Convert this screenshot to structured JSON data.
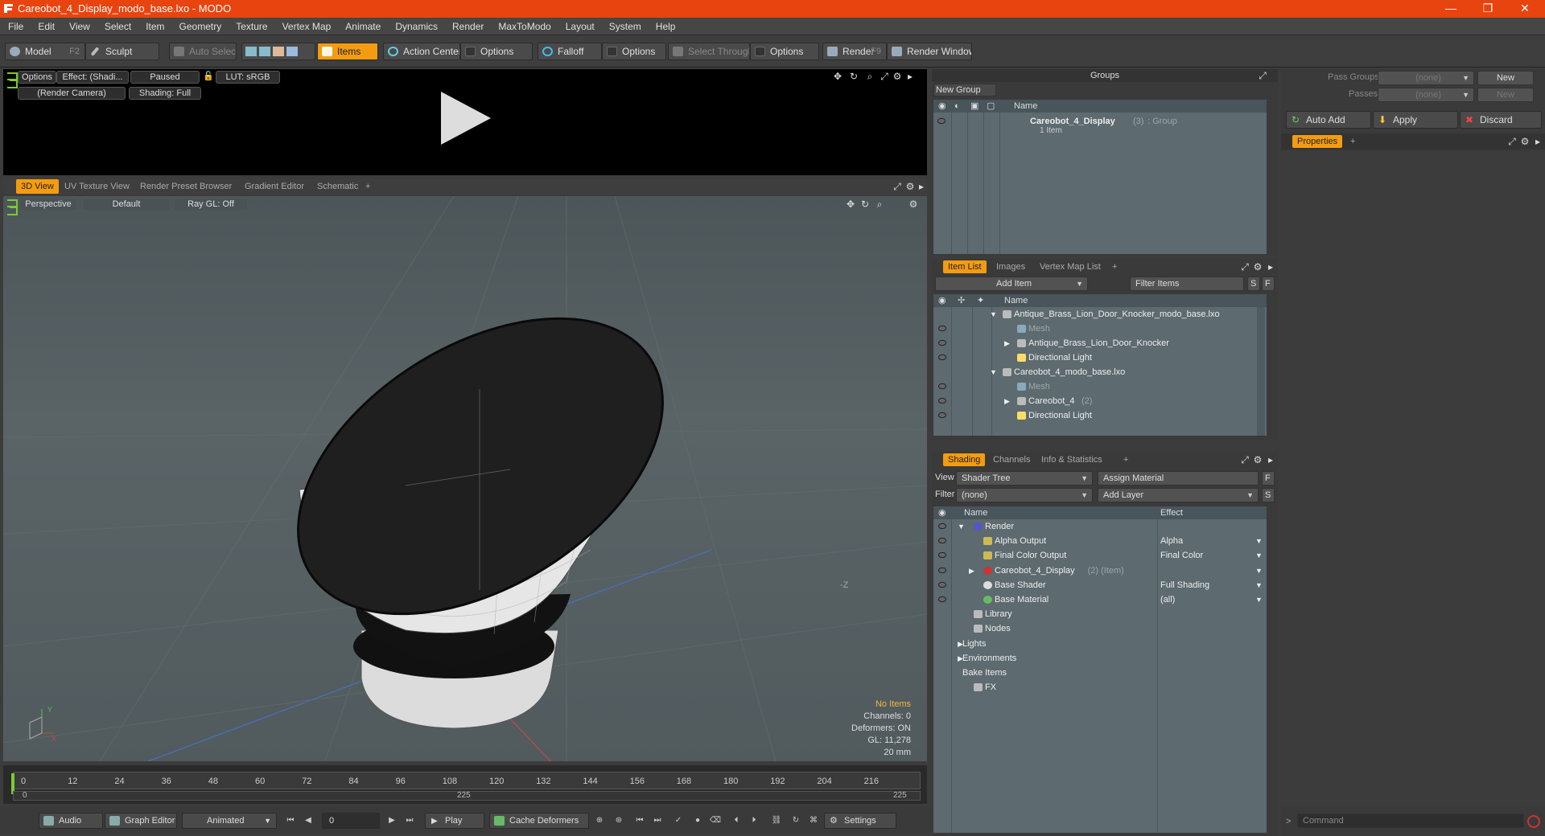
{
  "window": {
    "title": "Careobot_4_Display_modo_base.lxo - MODO",
    "minimize": "—",
    "maximize": "❐",
    "close": "✕"
  },
  "menu": [
    "File",
    "Edit",
    "View",
    "Select",
    "Item",
    "Geometry",
    "Texture",
    "Vertex Map",
    "Animate",
    "Dynamics",
    "Render",
    "MaxToModo",
    "Layout",
    "System",
    "Help"
  ],
  "toolbar": {
    "model": "Model",
    "model_key": "F2",
    "sculpt": "Sculpt",
    "auto_select": "Auto Select",
    "items": "Items",
    "action_center": "Action Center",
    "options1": "Options",
    "falloff": "Falloff",
    "options2": "Options",
    "select_through": "Select Through",
    "options3": "Options",
    "render": "Render",
    "render_key": "F9",
    "render_window": "Render Window"
  },
  "preview": {
    "options": "Options",
    "effect": "Effect: (Shadi...",
    "paused": "Paused",
    "lut": "LUT: sRGB",
    "camera": "(Render Camera)",
    "shading": "Shading: Full"
  },
  "view_tabs": [
    "3D View",
    "UV Texture View",
    "Render Preset Browser",
    "Gradient Editor",
    "Schematic",
    "+"
  ],
  "viewport": {
    "perspective": "Perspective",
    "default": "Default",
    "raygl": "Ray GL: Off",
    "axis_label": "-Z",
    "info": [
      "No Items",
      "Channels: 0",
      "Deformers: ON",
      "GL: 11,278",
      "20 mm"
    ]
  },
  "timeline": {
    "ticks": [
      "0",
      "12",
      "24",
      "36",
      "48",
      "60",
      "72",
      "84",
      "96",
      "108",
      "120",
      "132",
      "144",
      "156",
      "168",
      "180",
      "192",
      "204",
      "216"
    ],
    "start": "0",
    "mid": "225",
    "end": "225"
  },
  "bottom": {
    "audio": "Audio",
    "graph_editor": "Graph Editor",
    "animated": "Animated",
    "frame": "0",
    "play": "Play",
    "cache": "Cache Deformers",
    "settings": "Settings"
  },
  "groups": {
    "title": "Groups",
    "new_group": "New Group",
    "col_name": "Name",
    "item_name": "Careobot_4_Display",
    "item_count": "(3)",
    "item_type": ": Group",
    "item_sub": "1 Item"
  },
  "itemlist": {
    "tabs": [
      "Item List",
      "Images",
      "Vertex Map List",
      "+"
    ],
    "add_item": "Add Item",
    "filter": "Filter Items",
    "s": "S",
    "f": "F",
    "col_name": "Name",
    "rows": [
      {
        "label": "Antique_Brass_Lion_Door_Knocker_modo_base.lxo",
        "indent": 0,
        "dim": false
      },
      {
        "label": "Mesh",
        "indent": 1,
        "dim": true
      },
      {
        "label": "Antique_Brass_Lion_Door_Knocker",
        "indent": 1,
        "dim": false
      },
      {
        "label": "Directional Light",
        "indent": 1,
        "dim": false
      },
      {
        "label": "Careobot_4_modo_base.lxo",
        "indent": 0,
        "dim": false
      },
      {
        "label": "Mesh",
        "indent": 1,
        "dim": true
      },
      {
        "label": "Careobot_4",
        "indent": 1,
        "dim": false,
        "extra": "(2)"
      },
      {
        "label": "Directional Light",
        "indent": 1,
        "dim": false
      }
    ]
  },
  "shading": {
    "tabs": [
      "Shading",
      "Channels",
      "Info & Statistics",
      "+"
    ],
    "view_label": "View",
    "view_value": "Shader Tree",
    "assign": "Assign Material",
    "filter_label": "Filter",
    "filter_value": "(none)",
    "add_layer": "Add Layer",
    "col_name": "Name",
    "col_effect": "Effect",
    "rows": [
      {
        "label": "Render",
        "effect": ""
      },
      {
        "label": "Alpha Output",
        "effect": "Alpha"
      },
      {
        "label": "Final Color Output",
        "effect": "Final Color"
      },
      {
        "label": "Careobot_4_Display",
        "extra": "(2) (Item)",
        "effect": ""
      },
      {
        "label": "Base Shader",
        "effect": "Full Shading"
      },
      {
        "label": "Base Material",
        "effect": "(all)"
      },
      {
        "label": "Library",
        "effect": ""
      },
      {
        "label": "Nodes",
        "effect": ""
      },
      {
        "label": "Lights",
        "effect": ""
      },
      {
        "label": "Environments",
        "effect": ""
      },
      {
        "label": "Bake Items",
        "effect": ""
      },
      {
        "label": "FX",
        "effect": ""
      }
    ]
  },
  "right": {
    "pass_groups": "Pass Groups",
    "passes": "Passes",
    "none": "(none)",
    "new": "New",
    "auto_add": "Auto Add",
    "apply": "Apply",
    "discard": "Discard",
    "properties": "Properties",
    "command": "Command"
  },
  "colors": {
    "accent": "#f39c12",
    "title": "#e8440f"
  }
}
